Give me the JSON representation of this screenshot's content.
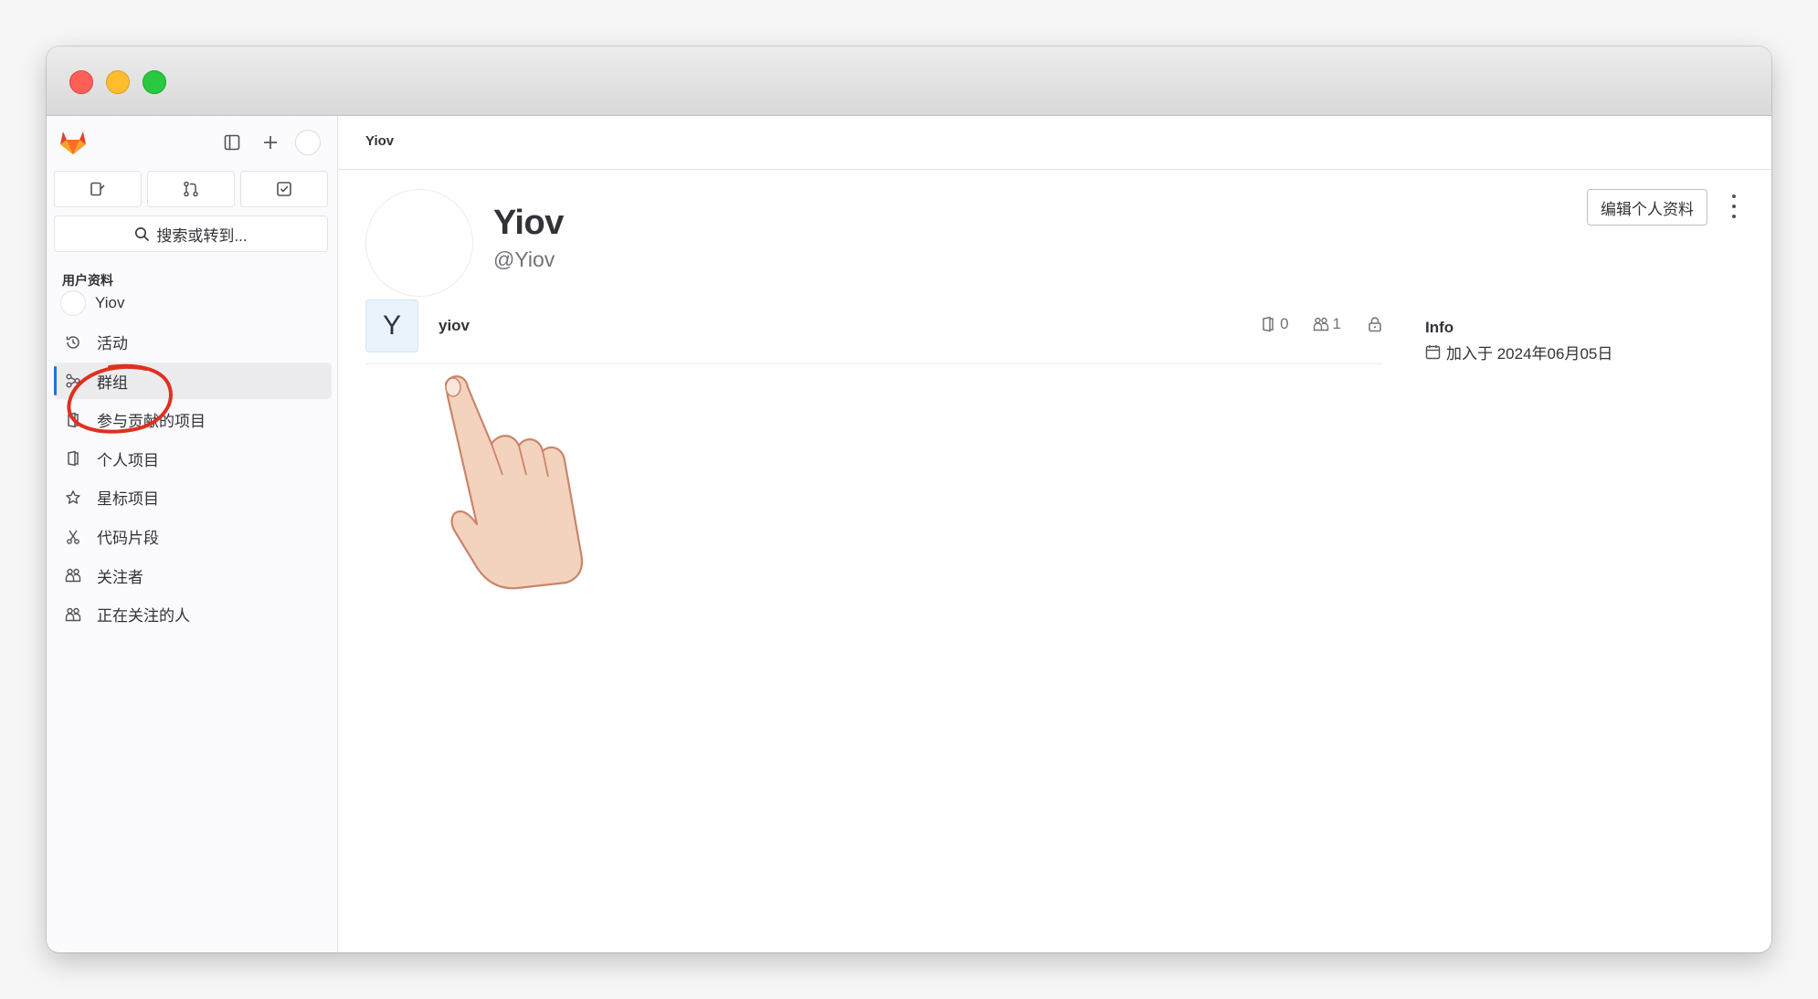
{
  "window": {
    "traffic_lights": [
      "close",
      "minimize",
      "zoom"
    ]
  },
  "sidebar": {
    "search_label": "搜索或转到...",
    "section_title": "用户资料",
    "items": [
      {
        "label": "Yiov",
        "icon": "avatar",
        "active": false
      },
      {
        "label": "活动",
        "icon": "history-icon",
        "active": false
      },
      {
        "label": "群组",
        "icon": "group-icon",
        "active": true
      },
      {
        "label": "参与贡献的项目",
        "icon": "project-icon",
        "active": false
      },
      {
        "label": "个人项目",
        "icon": "project-icon",
        "active": false
      },
      {
        "label": "星标项目",
        "icon": "star-icon",
        "active": false
      },
      {
        "label": "代码片段",
        "icon": "snippet-icon",
        "active": false
      },
      {
        "label": "关注者",
        "icon": "users-icon",
        "active": false
      },
      {
        "label": "正在关注的人",
        "icon": "users-icon",
        "active": false
      }
    ]
  },
  "breadcrumb": "Yiov",
  "profile": {
    "name": "Yiov",
    "handle": "@Yiov",
    "edit_label": "编辑个人资料"
  },
  "group": {
    "avatar_letter": "Y",
    "name": "yiov",
    "projects_count": "0",
    "members_count": "1"
  },
  "info": {
    "title": "Info",
    "joined": "加入于 2024年06月05日"
  },
  "colors": {
    "accent": "#1f75cb",
    "annotation_circle": "#e0301e"
  }
}
